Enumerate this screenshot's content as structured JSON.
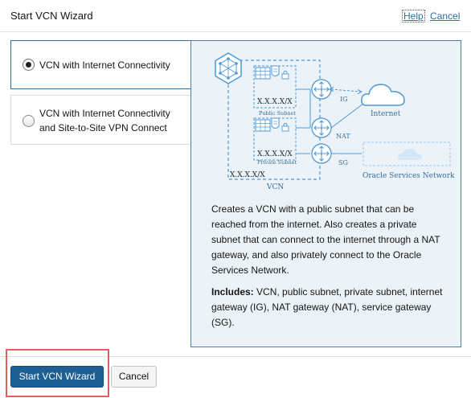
{
  "header": {
    "title": "Start VCN Wizard",
    "help_label": "Help",
    "cancel_label": "Cancel"
  },
  "options": [
    {
      "label": "VCN with Internet Connectivity",
      "selected": true
    },
    {
      "label": "VCN with Internet Connectivity and Site-to-Site VPN Connect",
      "selected": false
    }
  ],
  "diagram": {
    "public_subnet_label": "Public Subnet",
    "public_cidr": "X.X.X.X/X",
    "private_subnet_label": "Private Subnet",
    "private_cidr": "X.X.X.X/X",
    "vcn_cidr": "X.X.X.X/X",
    "vcn_label": "VCN",
    "ig_label": "IG",
    "nat_label": "NAT",
    "sg_label": "SG",
    "internet_label": "Internet",
    "oracle_services_label": "Oracle Services Network",
    "accent_color": "#4d9ad6"
  },
  "description": "Creates a VCN with a public subnet that can be reached from the internet. Also creates a private subnet that can connect to the internet through a NAT gateway, and also privately connect to the Oracle Services Network.",
  "includes": {
    "label": "Includes:",
    "text": " VCN, public subnet, private subnet, internet gateway (IG), NAT gateway (NAT), service gateway (SG)."
  },
  "footer": {
    "start_label": "Start VCN Wizard",
    "cancel_label": "Cancel"
  }
}
